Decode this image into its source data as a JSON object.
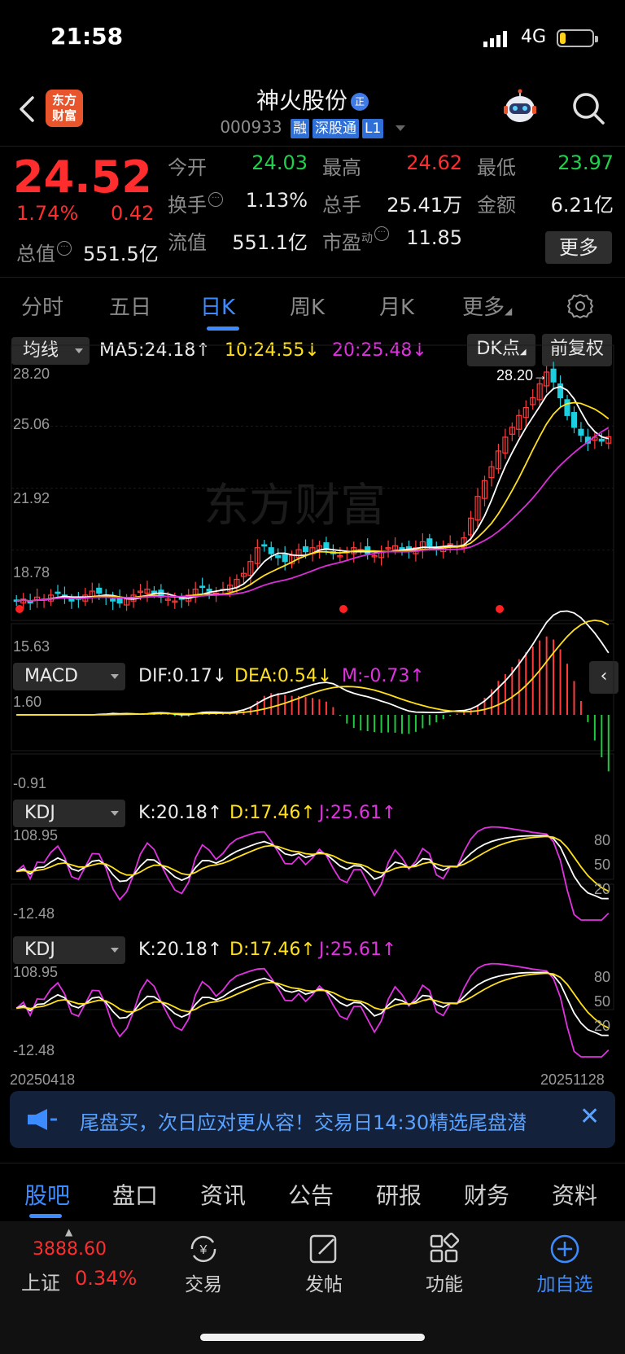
{
  "status": {
    "time": "21:58",
    "network": "4G",
    "battery_level": 0.18
  },
  "header": {
    "logo_line1": "东方",
    "logo_line2": "财富",
    "stock_name": "神火股份",
    "name_badge": "正",
    "code": "000933",
    "tags": [
      "融",
      "深股通",
      "L1"
    ]
  },
  "quote": {
    "price": "24.52",
    "change_pct": "1.74%",
    "change_amt": "0.42",
    "total_cap_label": "总值",
    "total_cap": "551.5亿",
    "open_label": "今开",
    "open": "24.03",
    "high_label": "最高",
    "high": "24.62",
    "low_label": "最低",
    "low": "23.97",
    "turnover_label": "换手",
    "turnover": "1.13%",
    "volume_label": "总手",
    "volume": "25.41万",
    "amount_label": "金额",
    "amount": "6.21亿",
    "float_cap_label": "流值",
    "float_cap": "551.1亿",
    "pe_label": "市盈",
    "pe_sup": "动",
    "pe": "11.85",
    "more_button": "更多"
  },
  "period_tabs": [
    "分时",
    "五日",
    "日K",
    "周K",
    "月K",
    "更多"
  ],
  "active_period": "日K",
  "chart_toolbar": {
    "ma_selector": "均线",
    "ma5": "MA5:24.18↑",
    "ma10": "10:24.55↓",
    "ma20": "20:25.48↓",
    "dk_button": "DK点",
    "adjust_button": "前复权"
  },
  "indicators": {
    "macd_selector": "MACD",
    "macd_dif": "DIF:0.17↓",
    "macd_dea": "DEA:0.54↓",
    "macd_m": "M:-0.73↑",
    "kdj_selector": "KDJ",
    "kdj_k": "K:20.18↑",
    "kdj_d": "D:17.46↑",
    "kdj_j": "J:25.61↑"
  },
  "chart_data": {
    "type": "candlestick",
    "price_axis_labels": [
      "28.20",
      "25.06",
      "21.92",
      "18.78",
      "15.63"
    ],
    "macd_axis_labels": [
      "1.60",
      "-0.91"
    ],
    "kdj_axis_left": [
      "108.95",
      "-12.48"
    ],
    "kdj_axis_right": [
      "80",
      "50",
      "20"
    ],
    "high_marker": "28.20",
    "x_start": "20250418",
    "x_end": "20251128",
    "watermark": "东方财富",
    "close_series": [
      16.2,
      16.3,
      16.1,
      16.4,
      16.3,
      16.5,
      16.6,
      16.4,
      16.2,
      16.3,
      16.5,
      16.7,
      16.6,
      16.4,
      16.2,
      16.1,
      16.3,
      16.5,
      16.7,
      16.8,
      16.6,
      16.4,
      16.3,
      16.2,
      16.3,
      16.5,
      16.8,
      16.9,
      16.7,
      16.6,
      16.8,
      17.0,
      17.3,
      17.6,
      18.2,
      18.9,
      19.0,
      18.6,
      18.4,
      18.2,
      18.5,
      18.8,
      18.7,
      18.9,
      19.0,
      18.8,
      18.6,
      18.5,
      18.7,
      18.9,
      18.8,
      18.6,
      18.5,
      18.7,
      18.9,
      19.0,
      18.8,
      18.7,
      18.9,
      19.2,
      19.0,
      18.8,
      18.9,
      19.1,
      19.0,
      19.4,
      20.4,
      21.5,
      22.3,
      23.0,
      23.8,
      24.5,
      25.0,
      25.6,
      26.0,
      26.5,
      27.2,
      27.8,
      27.3,
      26.5,
      25.6,
      25.0,
      24.6,
      24.2,
      24.5,
      24.3,
      24.52
    ]
  },
  "banner": {
    "text": "尾盘买，次日应对更从容！交易日14:30精选尾盘潜",
    "close": "✕"
  },
  "bottom_tabs": [
    "股吧",
    "盘口",
    "资讯",
    "公告",
    "研报",
    "财务",
    "资料"
  ],
  "active_bottom_tab": "股吧",
  "index": {
    "value": "3888.60",
    "name": "上证",
    "pct": "0.34%"
  },
  "actions": [
    "交易",
    "发帖",
    "功能",
    "加自选"
  ]
}
